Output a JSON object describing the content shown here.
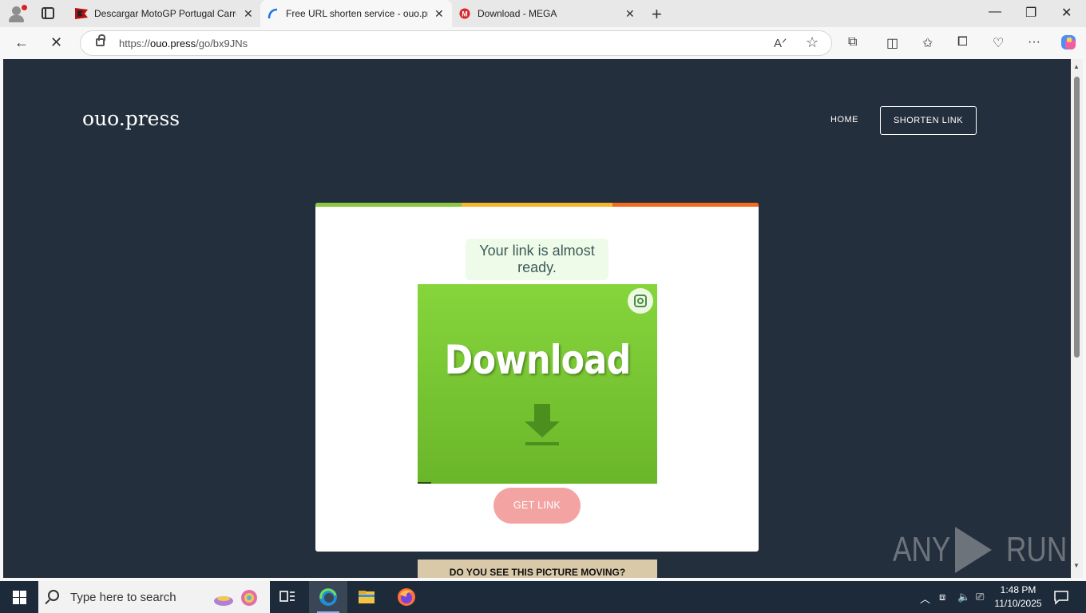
{
  "browser": {
    "tabs": [
      {
        "title": "Descargar MotoGP Portugal Carre",
        "favicon": "motogp-flag-icon"
      },
      {
        "title": "Free URL shorten service - ouo.pre",
        "favicon": "ouo-swirl-icon",
        "active": true
      },
      {
        "title": "Download - MEGA",
        "favicon": "mega-icon"
      }
    ],
    "url_prefix": "https://",
    "url_host": "ouo.press",
    "url_path": "/go/bx9JNs"
  },
  "page": {
    "logo": "ouo.press",
    "nav": {
      "home": "HOME",
      "shorten": "SHORTEN LINK"
    },
    "ready_text": "Your link is almost ready.",
    "ad_text": "Download",
    "get_link": "GET LINK",
    "banner_text": "DO YOU SEE THIS PICTURE MOVING?",
    "stripe_colors": [
      "#8dc63f",
      "#f7b52b",
      "#f26b21"
    ]
  },
  "watermark": {
    "left": "ANY",
    "right": "RUN"
  },
  "taskbar": {
    "search_placeholder": "Type here to search",
    "time": "1:48 PM",
    "date": "11/10/2025"
  }
}
